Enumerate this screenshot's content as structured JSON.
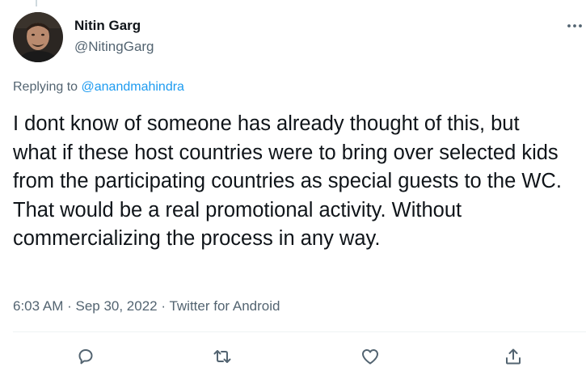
{
  "author": {
    "name": "Nitin Garg",
    "handle": "@NitingGarg"
  },
  "reply_context": {
    "prefix": "Replying to ",
    "mention": "@anandmahindra"
  },
  "tweet_text": "I dont know of someone has already thought of this, but what if these host countries were to bring over selected kids from the participating countries as special guests to the WC. That would be a real promotional activity. Without commercializing the process in any way.",
  "meta": {
    "time": "6:03 AM",
    "separator": " · ",
    "date": "Sep 30, 2022",
    "source": "Twitter for Android"
  },
  "actions": [
    "reply-icon",
    "retweet-icon",
    "like-icon",
    "share-icon"
  ],
  "colors": {
    "text": "#0f1419",
    "secondary": "#536471",
    "link": "#1d9bf0",
    "divider": "#eff3f4"
  }
}
